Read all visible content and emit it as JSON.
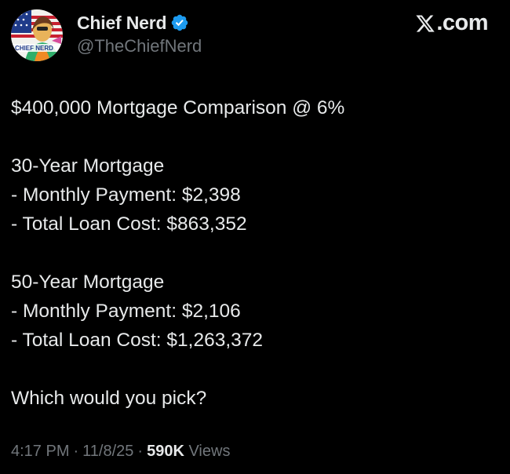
{
  "author": {
    "display_name": "Chief Nerd",
    "handle": "@TheChiefNerd",
    "avatar_text": "CHIEF NERD",
    "verified": true
  },
  "brand": {
    "label": ".com",
    "icon": "x-logo-icon"
  },
  "post": {
    "lines": [
      "$400,000 Mortgage Comparison @ 6%",
      "",
      "30-Year Mortgage",
      "- Monthly Payment: $2,398",
      "- Total Loan Cost: $863,352",
      "",
      "50-Year Mortgage",
      "- Monthly Payment: $2,106",
      "- Total Loan Cost: $1,263,372",
      "",
      "Which would you pick?"
    ]
  },
  "meta": {
    "time": "4:17 PM",
    "date": "11/8/25",
    "views_count": "590K",
    "views_label": "Views"
  },
  "colors": {
    "background": "#000000",
    "text": "#e7e9ea",
    "secondary": "#71767b",
    "verified": "#1d9bf0"
  }
}
